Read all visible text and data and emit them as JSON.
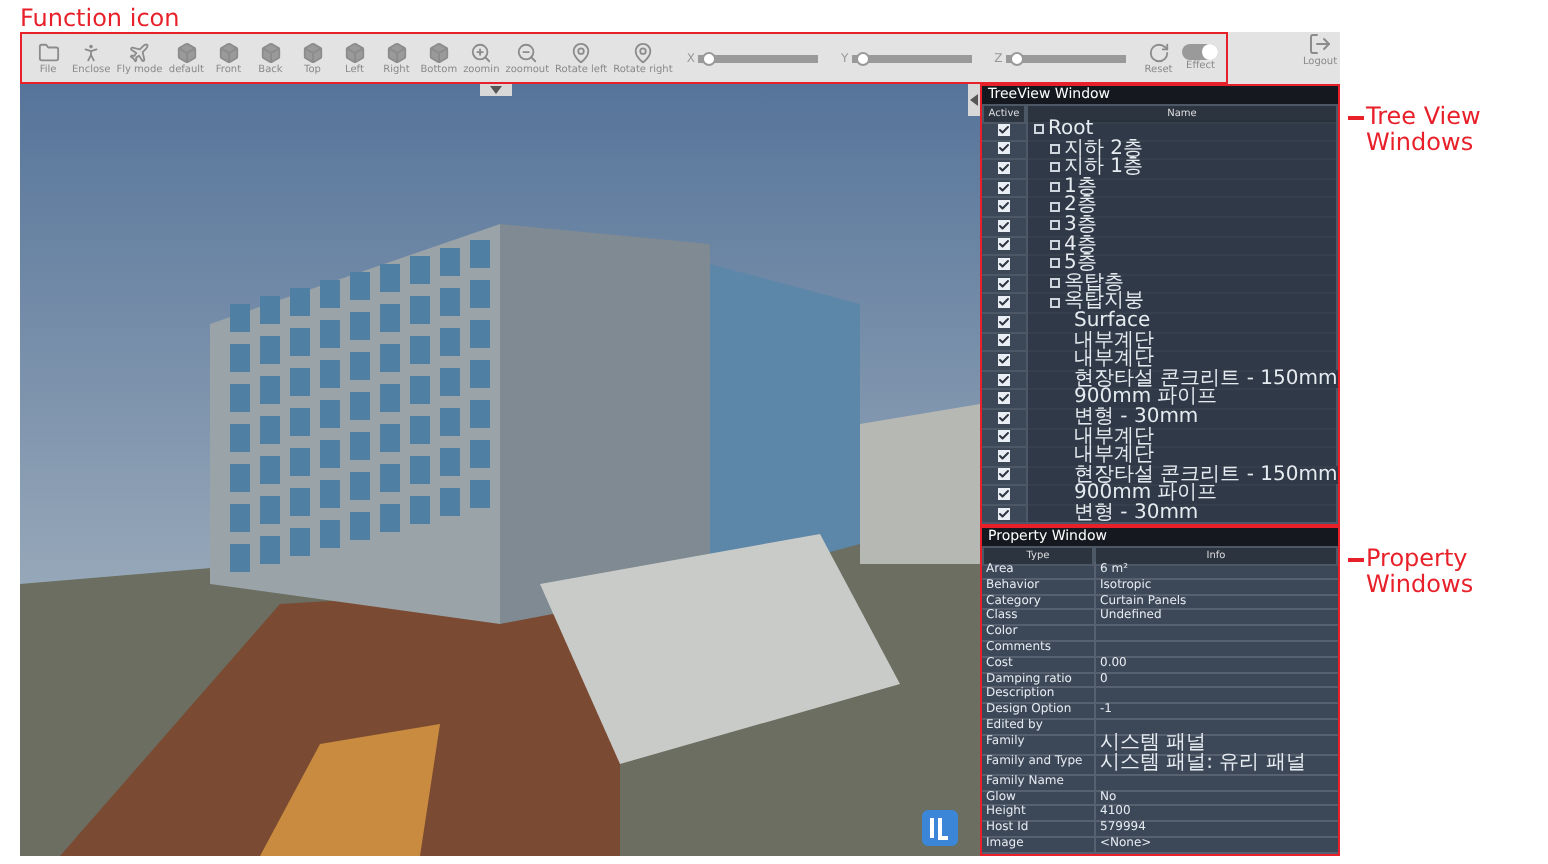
{
  "notes": {
    "function": "Function icon",
    "tree": "Tree View Windows",
    "property": "Property Windows"
  },
  "toolbar": {
    "tools": [
      {
        "label": "File",
        "kind": "file"
      },
      {
        "label": "Enclose",
        "kind": "walk"
      },
      {
        "label": "Fly mode",
        "kind": "fly"
      },
      {
        "label": "default",
        "kind": "cube"
      },
      {
        "label": "Front",
        "kind": "cube"
      },
      {
        "label": "Back",
        "kind": "cube"
      },
      {
        "label": "Top",
        "kind": "cube"
      },
      {
        "label": "Left",
        "kind": "cube"
      },
      {
        "label": "Right",
        "kind": "cube"
      },
      {
        "label": "Bottom",
        "kind": "cube"
      },
      {
        "label": "zoomin",
        "kind": "zoomin"
      },
      {
        "label": "zoomout",
        "kind": "zoomout"
      },
      {
        "label": "Rotate left",
        "kind": "pin"
      },
      {
        "label": "Rotate right",
        "kind": "pin"
      }
    ],
    "sliders": [
      {
        "label": "X",
        "level": 0.03
      },
      {
        "label": "Y",
        "level": 0.03
      },
      {
        "label": "Z",
        "level": 0.03
      }
    ],
    "reset": "Reset",
    "effect": {
      "label": "Effect",
      "on": true
    },
    "logout": "Logout"
  },
  "tree": {
    "title": "TreeView Window",
    "columns": [
      "Active",
      "Name"
    ],
    "nodes": [
      {
        "name": "Root",
        "kind": "group",
        "checked": true,
        "children": [
          {
            "name": "지하 2층",
            "kind": "group",
            "checked": true
          },
          {
            "name": "지하 1층",
            "kind": "group",
            "checked": true
          },
          {
            "name": "1층",
            "kind": "group",
            "checked": true
          },
          {
            "name": "2층",
            "kind": "group",
            "checked": true
          },
          {
            "name": "3층",
            "kind": "group",
            "checked": true
          },
          {
            "name": "4층",
            "kind": "group",
            "checked": true
          },
          {
            "name": "5층",
            "kind": "group",
            "checked": true
          },
          {
            "name": "옥탑층",
            "kind": "group",
            "checked": true
          },
          {
            "name": "옥탑지붕",
            "kind": "group",
            "checked": true,
            "children": [
              {
                "name": "Surface",
                "kind": "leaf",
                "checked": true
              },
              {
                "name": "내부계단",
                "kind": "leaf",
                "checked": true
              },
              {
                "name": "내부계단",
                "kind": "leaf",
                "checked": true
              },
              {
                "name": "현장타설 콘크리트 - 150mm",
                "kind": "leaf",
                "checked": true
              },
              {
                "name": "900mm 파이프",
                "kind": "leaf",
                "checked": true
              },
              {
                "name": "변형 - 30mm",
                "kind": "leaf",
                "checked": true
              },
              {
                "name": "내부계단",
                "kind": "leaf",
                "checked": true
              },
              {
                "name": "내부계단",
                "kind": "leaf",
                "checked": true
              },
              {
                "name": "현장타설 콘크리트 - 150mm",
                "kind": "leaf",
                "checked": true
              },
              {
                "name": "900mm 파이프",
                "kind": "leaf",
                "checked": true
              },
              {
                "name": "변형 - 30mm",
                "kind": "leaf",
                "checked": true
              }
            ]
          }
        ]
      }
    ]
  },
  "property": {
    "title": "Property Window",
    "columns": [
      "Type",
      "Info"
    ],
    "rows": [
      {
        "type": "Area",
        "info": "6 m²"
      },
      {
        "type": "Behavior",
        "info": "Isotropic"
      },
      {
        "type": "Category",
        "info": "Curtain Panels"
      },
      {
        "type": "Class",
        "info": "Undefined"
      },
      {
        "type": "Color"
      },
      {
        "type": "Comments"
      },
      {
        "type": "Cost",
        "info": "0.00"
      },
      {
        "type": "Damping ratio",
        "info": "0"
      },
      {
        "type": "Description"
      },
      {
        "type": "Design Option",
        "info": "-1"
      },
      {
        "type": "Edited by"
      },
      {
        "type": "Family",
        "info": "시스템 패널"
      },
      {
        "type": "Family and Type",
        "info": "시스템 패널: 유리 패널"
      },
      {
        "type": "Family Name"
      },
      {
        "type": "Glow",
        "info": "No"
      },
      {
        "type": "Height",
        "info": "4100"
      },
      {
        "type": "Host Id",
        "info": "579994"
      },
      {
        "type": "Image",
        "info": "<None>"
      }
    ]
  }
}
